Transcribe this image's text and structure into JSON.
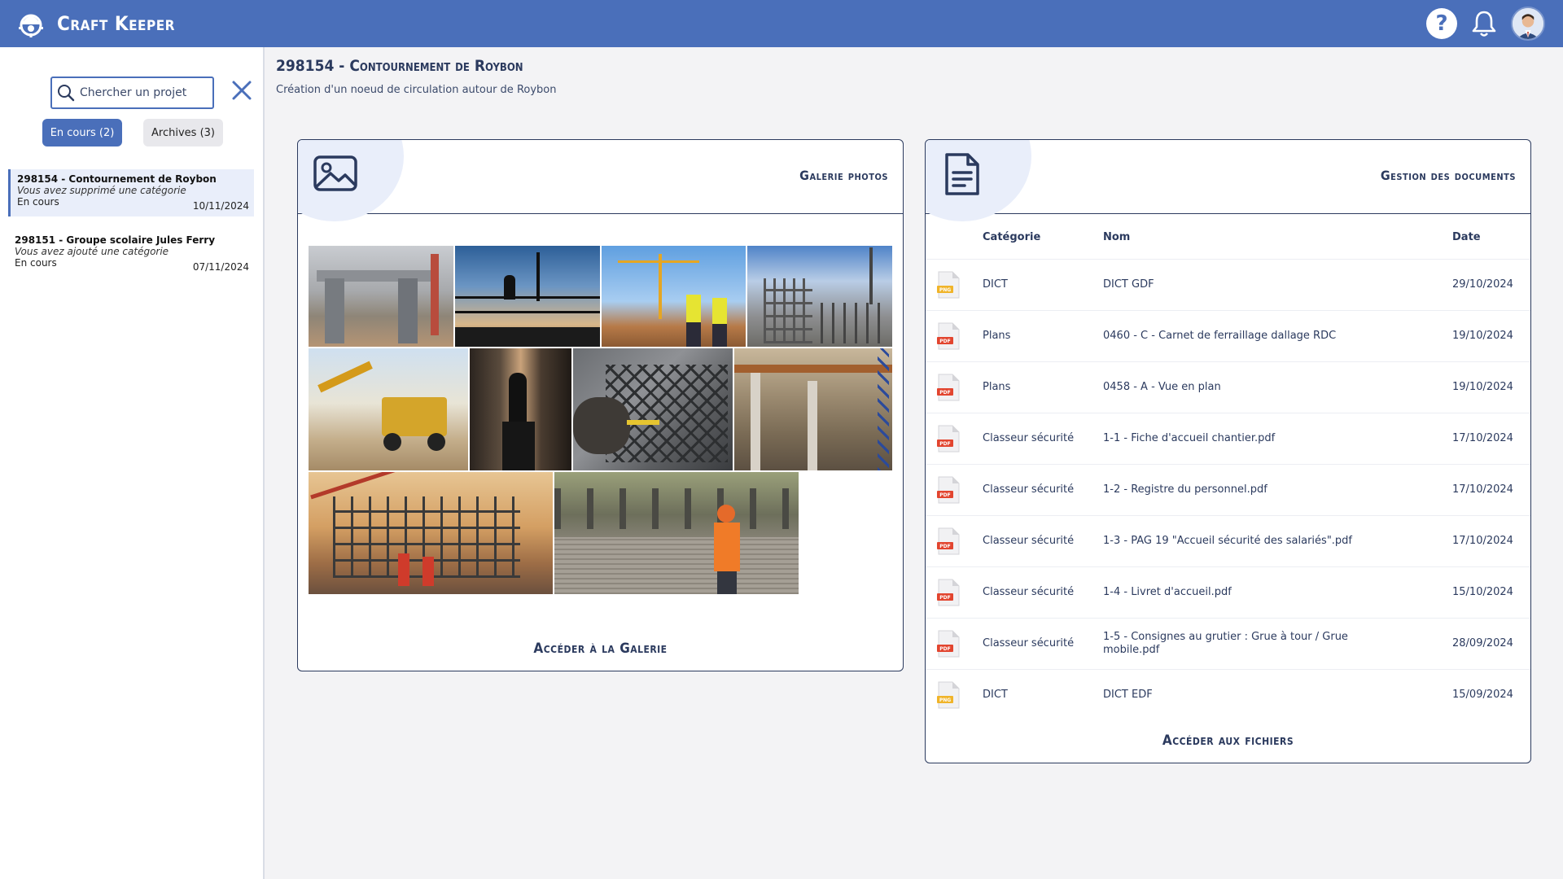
{
  "header": {
    "app_title": "Craft Keeper",
    "logo_icon": "helmet-gear-icon",
    "help_icon": "help-icon",
    "bell_icon": "bell-icon",
    "avatar_icon": "user-avatar"
  },
  "sidebar": {
    "search": {
      "placeholder": "Chercher un projet",
      "value": ""
    },
    "tabs": [
      {
        "label": "En cours (2)",
        "active": true
      },
      {
        "label": "Archives (3)",
        "active": false
      }
    ],
    "projects": [
      {
        "name": "298154 - Contournement de Roybon",
        "message": "Vous avez supprimé une catégorie",
        "status": "En cours",
        "date": "10/11/2024",
        "selected": true
      },
      {
        "name": "298151 - Groupe scolaire Jules Ferry",
        "message": "Vous avez ajouté une catégorie",
        "status": "En cours",
        "date": "07/11/2024",
        "selected": false
      }
    ]
  },
  "main": {
    "title": "298154 - Contournement de Roybon",
    "subtitle": "Création d'un noeud de circulation autour de Roybon"
  },
  "gallery": {
    "title": "Galerie photos",
    "link": "Accéder à la Galerie",
    "icon": "image-icon"
  },
  "documents": {
    "title": "Gestion des documents",
    "link": "Accéder aux fichiers",
    "icon": "document-icon",
    "columns": {
      "category": "Catégorie",
      "name": "Nom",
      "date": "Date"
    },
    "rows": [
      {
        "type": "PNG",
        "category": "DICT",
        "name": "DICT GDF",
        "date": "29/10/2024"
      },
      {
        "type": "PDF",
        "category": "Plans",
        "name": "0460 - C - Carnet de ferraillage dallage RDC",
        "date": "19/10/2024"
      },
      {
        "type": "PDF",
        "category": "Plans",
        "name": "0458 - A - Vue en plan",
        "date": "19/10/2024"
      },
      {
        "type": "PDF",
        "category": "Classeur sécurité",
        "name": "1-1 - Fiche d'accueil chantier.pdf",
        "date": "17/10/2024"
      },
      {
        "type": "PDF",
        "category": "Classeur sécurité",
        "name": "1-2 - Registre du personnel.pdf",
        "date": "17/10/2024"
      },
      {
        "type": "PDF",
        "category": "Classeur sécurité",
        "name": "1-3 - PAG 19 \"Accueil sécurité des salariés\".pdf",
        "date": "17/10/2024"
      },
      {
        "type": "PDF",
        "category": "Classeur sécurité",
        "name": "1-4 - Livret d'accueil.pdf",
        "date": "15/10/2024"
      },
      {
        "type": "PDF",
        "category": "Classeur sécurité",
        "name": "1-5 - Consignes au grutier : Grue à tour / Grue mobile.pdf",
        "date": "28/09/2024"
      },
      {
        "type": "PNG",
        "category": "DICT",
        "name": "DICT EDF",
        "date": "15/09/2024"
      }
    ]
  }
}
